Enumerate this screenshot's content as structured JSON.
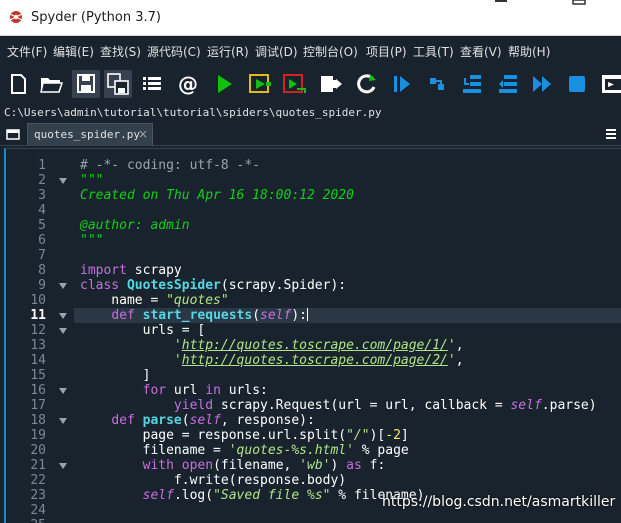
{
  "window": {
    "title": "Spyder (Python 3.7)"
  },
  "menu": [
    {
      "label": "文件(F)"
    },
    {
      "label": "编辑(E)"
    },
    {
      "label": "查找(S)"
    },
    {
      "label": "源代码(C)"
    },
    {
      "label": "运行(R)"
    },
    {
      "label": "调试(D)"
    },
    {
      "label": "控制台(O)"
    },
    {
      "label": "项目(P)"
    },
    {
      "label": "工具(T)"
    },
    {
      "label": "查看(V)"
    },
    {
      "label": "帮助(H)"
    }
  ],
  "toolbar": {
    "buttons": [
      {
        "icon": "new-file-icon"
      },
      {
        "icon": "open-folder-icon"
      },
      {
        "icon": "save-icon"
      },
      {
        "icon": "save-all-icon"
      },
      {
        "icon": "list-icon"
      },
      {
        "icon": "at-icon"
      },
      {
        "icon": "run-icon"
      },
      {
        "icon": "run-cell-icon"
      },
      {
        "icon": "run-cell-advance-icon"
      },
      {
        "icon": "run-selection-icon"
      },
      {
        "icon": "rerun-icon"
      },
      {
        "icon": "debug-icon"
      },
      {
        "icon": "step-icon"
      },
      {
        "icon": "step-into-icon"
      },
      {
        "icon": "step-return-icon"
      },
      {
        "icon": "continue-icon"
      },
      {
        "icon": "stop-icon"
      },
      {
        "icon": "maximize-pane-icon"
      }
    ],
    "colors": {
      "icon": "#ffffff",
      "run": "#11c011",
      "blue": "#1a8fe0",
      "warn": "#e8b90f",
      "red": "#d22323"
    }
  },
  "path": "C:\\Users\\admin\\tutorial\\tutorial\\spiders\\quotes_spider.py",
  "tab": {
    "label": "quotes_spider.py",
    "close": "×"
  },
  "editor": {
    "current_line": 11,
    "lines": [
      {
        "n": "1",
        "parts": [
          {
            "t": "# -*- coding: utf-8 -*-",
            "c": "comment"
          }
        ]
      },
      {
        "n": "2",
        "fold": true,
        "parts": [
          {
            "t": "\"\"\"",
            "c": "doc"
          }
        ]
      },
      {
        "n": "3",
        "parts": [
          {
            "t": "Created on Thu Apr 16 18:00:12 2020",
            "c": "doc"
          }
        ]
      },
      {
        "n": "4",
        "parts": []
      },
      {
        "n": "5",
        "parts": [
          {
            "t": "@author: admin",
            "c": "doc"
          }
        ]
      },
      {
        "n": "6",
        "parts": [
          {
            "t": "\"\"\"",
            "c": "doc"
          }
        ]
      },
      {
        "n": "7",
        "parts": []
      },
      {
        "n": "8",
        "parts": [
          {
            "t": "import",
            "c": "kw"
          },
          {
            "t": " scrapy",
            "c": "plain"
          }
        ]
      },
      {
        "n": "9",
        "fold": true,
        "parts": [
          {
            "t": "class",
            "c": "kw"
          },
          {
            "t": " ",
            "c": "plain"
          },
          {
            "t": "QuotesSpider",
            "c": "def"
          },
          {
            "t": "(scrapy.Spider):",
            "c": "plain"
          }
        ]
      },
      {
        "n": "10",
        "parts": [
          {
            "t": "    name = ",
            "c": "plain"
          },
          {
            "t": "\"quotes\"",
            "c": "str"
          }
        ]
      },
      {
        "n": "11",
        "fold": true,
        "parts": [
          {
            "t": "    ",
            "c": "plain"
          },
          {
            "t": "def",
            "c": "kw"
          },
          {
            "t": " ",
            "c": "plain"
          },
          {
            "t": "start_requests",
            "c": "def"
          },
          {
            "t": "(",
            "c": "plain"
          },
          {
            "t": "self",
            "c": "self"
          },
          {
            "t": "):",
            "c": "plain"
          }
        ],
        "cursor": true
      },
      {
        "n": "12",
        "fold": true,
        "parts": [
          {
            "t": "        urls = [",
            "c": "plain"
          }
        ]
      },
      {
        "n": "13",
        "parts": [
          {
            "t": "            '",
            "c": "str"
          },
          {
            "t": "http://quotes.toscrape.com/page/1/",
            "c": "url"
          },
          {
            "t": "'",
            "c": "str"
          },
          {
            "t": ",",
            "c": "plain"
          }
        ]
      },
      {
        "n": "14",
        "parts": [
          {
            "t": "            '",
            "c": "str"
          },
          {
            "t": "http://quotes.toscrape.com/page/2/",
            "c": "url"
          },
          {
            "t": "'",
            "c": "str"
          },
          {
            "t": ",",
            "c": "plain"
          }
        ]
      },
      {
        "n": "15",
        "parts": [
          {
            "t": "        ]",
            "c": "plain"
          }
        ]
      },
      {
        "n": "16",
        "fold": true,
        "parts": [
          {
            "t": "        ",
            "c": "plain"
          },
          {
            "t": "for",
            "c": "kw"
          },
          {
            "t": " url ",
            "c": "plain"
          },
          {
            "t": "in",
            "c": "kw"
          },
          {
            "t": " urls:",
            "c": "plain"
          }
        ]
      },
      {
        "n": "17",
        "parts": [
          {
            "t": "            ",
            "c": "plain"
          },
          {
            "t": "yield",
            "c": "kw"
          },
          {
            "t": " scrapy.Request(url = url, callback = ",
            "c": "plain"
          },
          {
            "t": "self",
            "c": "self"
          },
          {
            "t": ".parse)",
            "c": "plain"
          }
        ]
      },
      {
        "n": "18",
        "fold": true,
        "parts": [
          {
            "t": "    ",
            "c": "plain"
          },
          {
            "t": "def",
            "c": "kw"
          },
          {
            "t": " ",
            "c": "plain"
          },
          {
            "t": "parse",
            "c": "def"
          },
          {
            "t": "(",
            "c": "plain"
          },
          {
            "t": "self",
            "c": "self"
          },
          {
            "t": ", response):",
            "c": "plain"
          }
        ]
      },
      {
        "n": "19",
        "parts": [
          {
            "t": "        page = response.url.split(",
            "c": "plain"
          },
          {
            "t": "\"/\"",
            "c": "str"
          },
          {
            "t": ")[",
            "c": "plain"
          },
          {
            "t": "-2",
            "c": "num"
          },
          {
            "t": "]",
            "c": "plain"
          }
        ]
      },
      {
        "n": "20",
        "parts": [
          {
            "t": "        filename = ",
            "c": "plain"
          },
          {
            "t": "'quotes-%s.html'",
            "c": "str"
          },
          {
            "t": " % page",
            "c": "plain"
          }
        ]
      },
      {
        "n": "21",
        "fold": true,
        "parts": [
          {
            "t": "        ",
            "c": "plain"
          },
          {
            "t": "with",
            "c": "kw"
          },
          {
            "t": " ",
            "c": "plain"
          },
          {
            "t": "open",
            "c": "builtin"
          },
          {
            "t": "(filename, ",
            "c": "plain"
          },
          {
            "t": "'wb'",
            "c": "str"
          },
          {
            "t": ") ",
            "c": "plain"
          },
          {
            "t": "as",
            "c": "kw"
          },
          {
            "t": " f:",
            "c": "plain"
          }
        ]
      },
      {
        "n": "22",
        "parts": [
          {
            "t": "            f.write(response.body)",
            "c": "plain"
          }
        ]
      },
      {
        "n": "23",
        "parts": [
          {
            "t": "        ",
            "c": "plain"
          },
          {
            "t": "self",
            "c": "self"
          },
          {
            "t": ".log(",
            "c": "plain"
          },
          {
            "t": "\"Saved file %s\"",
            "c": "str"
          },
          {
            "t": " % filename)",
            "c": "plain"
          }
        ]
      },
      {
        "n": "24",
        "parts": []
      },
      {
        "n": "25",
        "parts": []
      }
    ]
  },
  "watermark": "https://blog.csdn.net/asmartkiller"
}
